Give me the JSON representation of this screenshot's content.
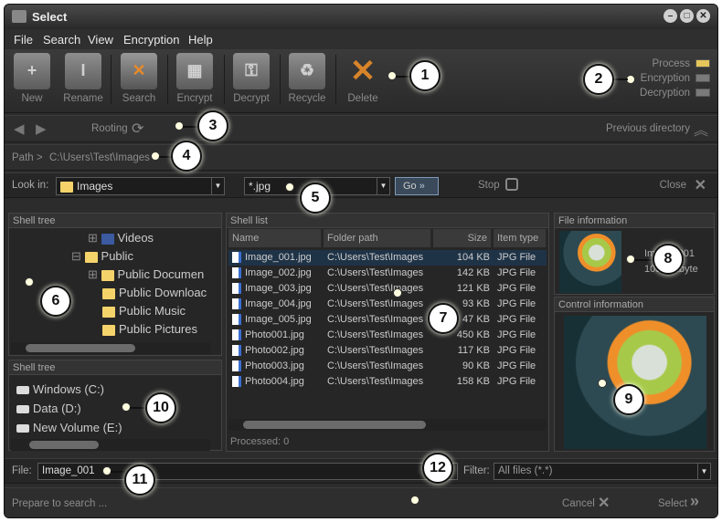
{
  "window": {
    "title": "Select"
  },
  "menu": [
    "File",
    "Search",
    "View",
    "Encryption",
    "Help"
  ],
  "toolbar": {
    "items": [
      {
        "label": "New",
        "icon": "new-icon"
      },
      {
        "label": "Rename",
        "icon": "rename-icon"
      },
      {
        "label": "Search",
        "icon": "search-icon"
      },
      {
        "label": "Encrypt",
        "icon": "encrypt-lock-icon"
      },
      {
        "label": "Decrypt",
        "icon": "decrypt-key-icon"
      },
      {
        "label": "Recycle",
        "icon": "recycle-icon"
      },
      {
        "label": "Delete",
        "icon": "delete-x-icon"
      }
    ]
  },
  "status_legend": [
    {
      "label": "Process",
      "color": "#e6c65a"
    },
    {
      "label": "Encryption",
      "color": "#7a7a7a"
    },
    {
      "label": "Decryption",
      "color": "#7a7a7a"
    }
  ],
  "nav": {
    "rooting": "Rooting",
    "previous": "Previous directory"
  },
  "path": {
    "label": "Path >",
    "value": "C:\\Users\\Test\\Images"
  },
  "search": {
    "look_in_label": "Look in:",
    "look_in_value": "Images",
    "mask": "*.jpg",
    "go": "Go",
    "stop": "Stop",
    "close": "Close"
  },
  "shell_tree": {
    "title": "Shell tree",
    "items": [
      "Videos",
      "Public",
      "Public Documen",
      "Public Downloac",
      "Public Music",
      "Public Pictures"
    ]
  },
  "drives": {
    "title": "Shell tree",
    "items": [
      "Windows (C:)",
      "Data (D:)",
      "New Volume (E:)"
    ]
  },
  "shell_list": {
    "title": "Shell list",
    "columns": [
      "Name",
      "Folder path",
      "Size",
      "Item type"
    ],
    "rows": [
      [
        "Image_001.jpg",
        "C:\\Users\\Test\\Images",
        "104 KB",
        "JPG File"
      ],
      [
        "Image_002.jpg",
        "C:\\Users\\Test\\Images",
        "142 KB",
        "JPG File"
      ],
      [
        "Image_003.jpg",
        "C:\\Users\\Test\\Images",
        "121 KB",
        "JPG File"
      ],
      [
        "Image_004.jpg",
        "C:\\Users\\Test\\Images",
        "93 KB",
        "JPG File"
      ],
      [
        "Image_005.jpg",
        "C:\\Users\\Test\\Images",
        "47 KB",
        "JPG File"
      ],
      [
        "Photo001.jpg",
        "C:\\Users\\Test\\Images",
        "450 KB",
        "JPG File"
      ],
      [
        "Photo002.jpg",
        "C:\\Users\\Test\\Images",
        "117 KB",
        "JPG File"
      ],
      [
        "Photo003.jpg",
        "C:\\Users\\Test\\Images",
        "90 KB",
        "JPG File"
      ],
      [
        "Photo004.jpg",
        "C:\\Users\\Test\\Images",
        "158 KB",
        "JPG File"
      ]
    ],
    "processed": "Processed: 0"
  },
  "file_info": {
    "title": "File information",
    "line1": "Image_001",
    "line2": "103,4 Kbyte"
  },
  "control_info": {
    "title": "Control information"
  },
  "bottom": {
    "file_label": "File:",
    "file_value": "Image_001",
    "filter_label": "Filter:",
    "filter_value": "All files (*.*)"
  },
  "status": {
    "text": "Prepare to search ...",
    "cancel": "Cancel",
    "select": "Select"
  },
  "callouts": [
    "1",
    "2",
    "3",
    "4",
    "5",
    "6",
    "7",
    "8",
    "9",
    "10",
    "11",
    "12"
  ]
}
